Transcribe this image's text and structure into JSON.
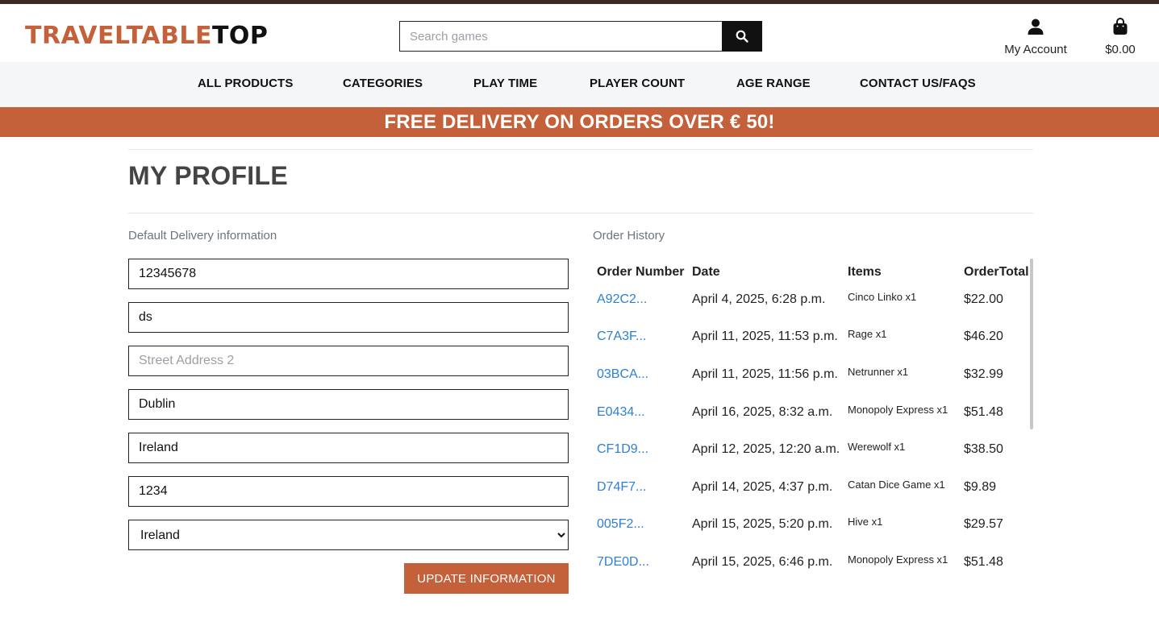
{
  "header": {
    "logo_part1": "TRAVELTABLE",
    "logo_part2": "TOP",
    "search_placeholder": "Search games",
    "account_label": "My Account",
    "bag_total": "$0.00"
  },
  "nav": {
    "items": [
      "ALL PRODUCTS",
      "CATEGORIES",
      "PLAY TIME",
      "PLAYER COUNT",
      "AGE RANGE",
      "CONTACT US/FAQS"
    ]
  },
  "banner": {
    "text": "FREE DELIVERY ON ORDERS OVER € 50!"
  },
  "page": {
    "title": "MY PROFILE"
  },
  "delivery": {
    "label": "Default Delivery information",
    "phone": "12345678",
    "street1": "ds",
    "street2_placeholder": "Street Address 2",
    "street2": "",
    "city": "Dublin",
    "county": "Ireland",
    "postcode": "1234",
    "country": "Ireland",
    "update_label": "UPDATE INFORMATION"
  },
  "orders": {
    "label": "Order History",
    "headers": [
      "Order Number",
      "Date",
      "Items",
      "OrderTotal"
    ],
    "rows": [
      {
        "number": "A92C2...",
        "date": "April 4, 2025, 6:28 p.m.",
        "items": "Cinco Linko x1",
        "total": "$22.00"
      },
      {
        "number": "C7A3F...",
        "date": "April 11, 2025, 11:53 p.m.",
        "items": "Rage x1",
        "total": "$46.20"
      },
      {
        "number": "03BCA...",
        "date": "April 11, 2025, 11:56 p.m.",
        "items": "Netrunner x1",
        "total": "$32.99"
      },
      {
        "number": "E0434...",
        "date": "April 16, 2025, 8:32 a.m.",
        "items": "Monopoly Express x1",
        "total": "$51.48"
      },
      {
        "number": "CF1D9...",
        "date": "April 12, 2025, 12:20 a.m.",
        "items": "Werewolf x1",
        "total": "$38.50"
      },
      {
        "number": "D74F7...",
        "date": "April 14, 2025, 4:37 p.m.",
        "items": "Catan Dice Game x1",
        "total": "$9.89"
      },
      {
        "number": "005F2...",
        "date": "April 15, 2025, 5:20 p.m.",
        "items": "Hive x1",
        "total": "$29.57"
      },
      {
        "number": "7DE0D...",
        "date": "April 15, 2025, 6:46 p.m.",
        "items": "Monopoly Express x1",
        "total": "$51.48"
      }
    ]
  },
  "colors": {
    "accent": "#c4603a",
    "link": "#2d7fd8",
    "dark": "#111111"
  },
  "icons": [
    "search-icon",
    "user-icon",
    "shopping-bag-icon"
  ]
}
